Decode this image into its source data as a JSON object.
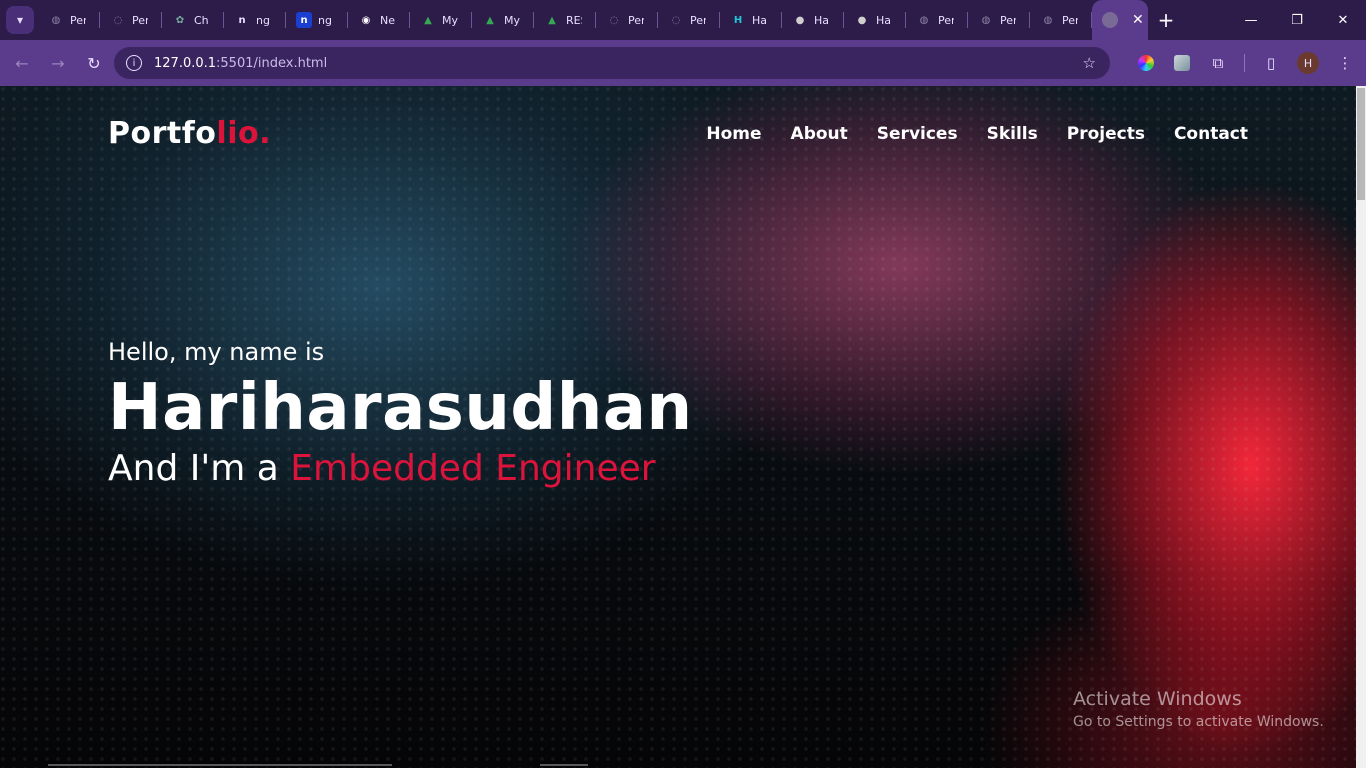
{
  "browser": {
    "tabs": [
      {
        "label": "Per",
        "icon": "globe-icon",
        "color": "#8f86a6"
      },
      {
        "label": "Per",
        "icon": "loading-icon",
        "color": "#8f86a6"
      },
      {
        "label": "Ch",
        "icon": "chatgpt-icon",
        "color": "#74aa9c"
      },
      {
        "label": "ng",
        "icon": "n-circle-icon",
        "color": "#e9ddff"
      },
      {
        "label": "ng",
        "icon": "n-square-icon",
        "color": "#1a3fd1"
      },
      {
        "label": "Ne",
        "icon": "chrome-icon",
        "color": "#ffffff"
      },
      {
        "label": "My",
        "icon": "drive-icon",
        "color": "#34a853"
      },
      {
        "label": "My",
        "icon": "drive-icon",
        "color": "#34a853"
      },
      {
        "label": "RES",
        "icon": "drive-icon",
        "color": "#34a853"
      },
      {
        "label": "Per",
        "icon": "loading-icon",
        "color": "#8f86a6"
      },
      {
        "label": "Per",
        "icon": "loading-icon",
        "color": "#8f86a6"
      },
      {
        "label": "Ha",
        "icon": "h-logo-icon",
        "color": "#1ec8d6"
      },
      {
        "label": "Ha",
        "icon": "github-icon",
        "color": "#cfcfcf"
      },
      {
        "label": "Ha",
        "icon": "github-icon",
        "color": "#cfcfcf"
      },
      {
        "label": "Per",
        "icon": "globe-icon",
        "color": "#8f86a6"
      },
      {
        "label": "Per",
        "icon": "globe-icon",
        "color": "#8f86a6"
      },
      {
        "label": "Per",
        "icon": "globe-icon",
        "color": "#8f86a6"
      }
    ],
    "active_tab_close": "✕",
    "new_tab": "+",
    "url_host": "127.0.0.1",
    "url_rest": ":5501/index.html",
    "avatar_initial": "H",
    "accent_color": "#5a3b8c"
  },
  "page": {
    "logo_main": "Portfo",
    "logo_accent": "lio.",
    "menu": [
      "Home",
      "About",
      "Services",
      "Skills",
      "Projects",
      "Contact"
    ],
    "hello": "Hello, my name is",
    "name": "Hariharasudhan",
    "role_prefix": "And I'm a ",
    "role_accent": "Embedded Engineer",
    "accent_color": "#dc143c"
  },
  "watermark": {
    "title": "Activate Windows",
    "subtitle": "Go to Settings to activate Windows."
  }
}
